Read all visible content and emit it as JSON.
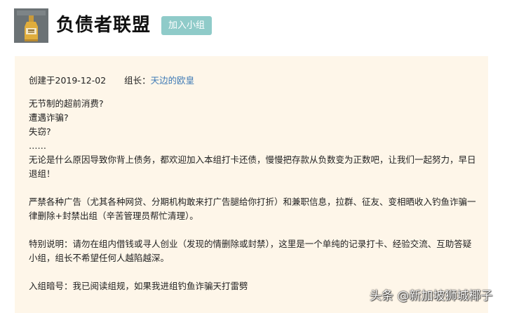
{
  "header": {
    "title": "负债者联盟",
    "join_button_label": "加入小组",
    "avatar": {
      "icon": "bottle-icon",
      "background": "#6b7275"
    },
    "button_color": "#8fcbc9"
  },
  "info": {
    "created_label": "创建于2019-12-02",
    "owner_label": "组长：",
    "owner_name": "天边的欧皇",
    "owner_link_color": "#3d79b5",
    "panel_background": "#fef6e9",
    "lines": {
      "q1": "无节制的超前消费?",
      "q2": "遭遇诈骗?",
      "q3": "失窃?",
      "ellipsis": "……",
      "intro": "无论是什么原因导致你背上债务，都欢迎加入本组打卡还债，慢慢把存款从负数变为正数吧，让我们一起努力，早日退组！",
      "rules": "严禁各种广告（尤其各种网贷、分期机构敢来打广告腿给你打折）和兼职信息，拉群、征友、变相晒收入钓鱼诈骗一律删除+封禁出组（辛苦管理员帮忙清理）。",
      "notice": "特别说明：请勿在组内借钱或寻人创业（发现的情删除或封禁），这里是一个单纯的记录打卡、经验交流、互助答疑小组，组长不希望任何人越陷越深。",
      "passphrase": "入组暗号：我已阅读组规，如果我进组钓鱼诈骗天打雷劈"
    }
  },
  "watermark": {
    "text": "头条 @新加坡狮城椰子"
  }
}
